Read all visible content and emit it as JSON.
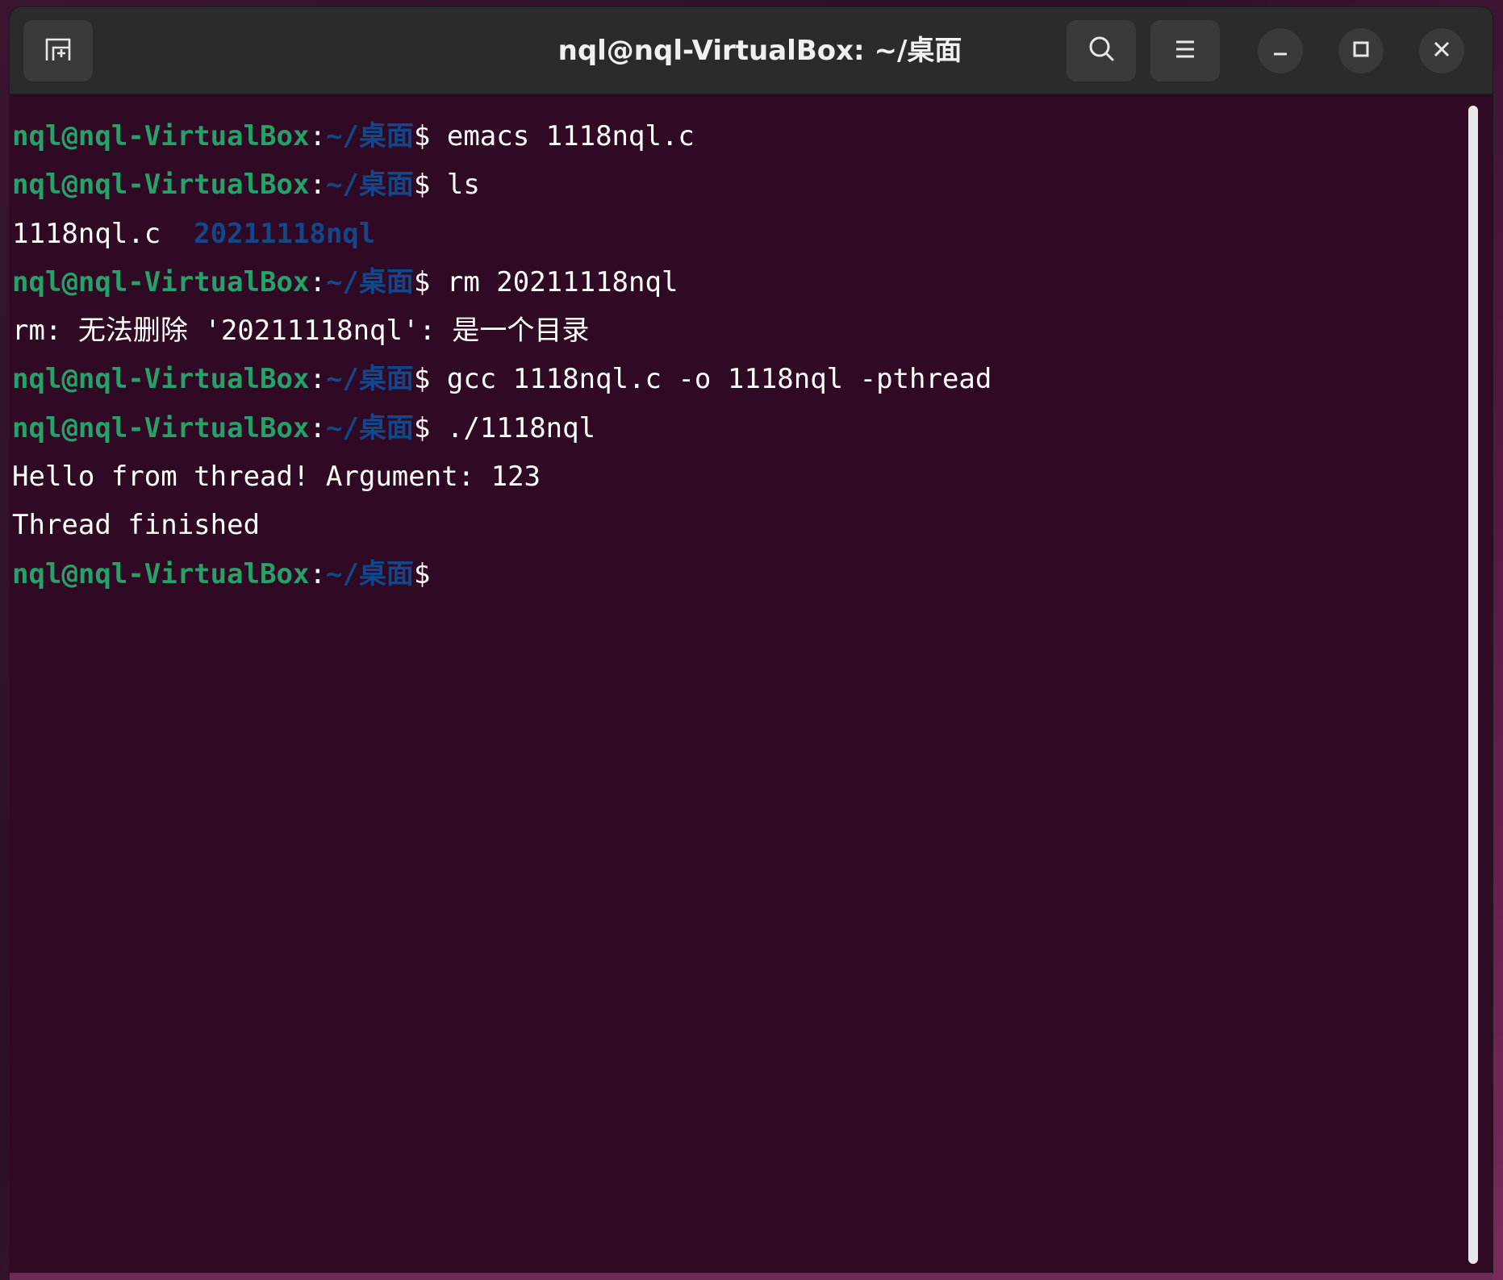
{
  "window": {
    "title": "nql@nql-VirtualBox: ~/桌面"
  },
  "icons": {
    "new_tab": "new-tab-icon",
    "search": "search-icon",
    "menu": "hamburger-menu-icon",
    "minimize": "minimize-icon",
    "maximize": "maximize-icon",
    "close": "close-icon"
  },
  "colors": {
    "terminal_bg": "#300a24",
    "prompt_user": "#26a269",
    "prompt_path": "#12488b",
    "text": "#ffffff",
    "headerbar": "#2b2b2b"
  },
  "prompt": {
    "user": "nql@nql-VirtualBox",
    "colon": ":",
    "path": "~/桌面",
    "dollar": "$"
  },
  "terminal": {
    "lines": [
      {
        "type": "command",
        "text": " emacs 1118nql.c"
      },
      {
        "type": "command",
        "text": " ls"
      },
      {
        "type": "ls",
        "file": "1118nql.c  ",
        "dir": "20211118nql"
      },
      {
        "type": "command",
        "text": " rm 20211118nql"
      },
      {
        "type": "output",
        "text": "rm: 无法删除 '20211118nql': 是一个目录"
      },
      {
        "type": "command",
        "text": " gcc 1118nql.c -o 1118nql -pthread"
      },
      {
        "type": "command",
        "text": " ./1118nql"
      },
      {
        "type": "output",
        "text": "Hello from thread! Argument: 123"
      },
      {
        "type": "output",
        "text": "Thread finished"
      },
      {
        "type": "command",
        "text": ""
      }
    ]
  }
}
